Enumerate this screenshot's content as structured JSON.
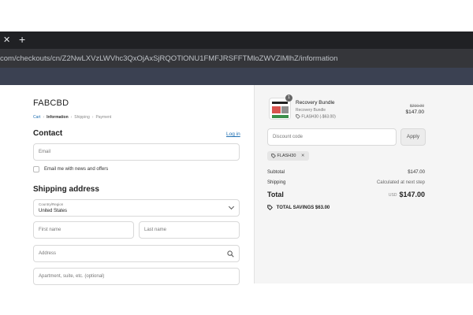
{
  "browser": {
    "tab_close": "✕",
    "tab_new": "+",
    "url": "com/checkouts/cn/Z2NwLXVzLWVhc3QxOjAxSjRQOTlONU1FMFJRSFFTMloZWVZlMlhZ/information"
  },
  "store": {
    "name": "FABCBD"
  },
  "breadcrumb": {
    "cart": "Cart",
    "information": "Information",
    "shipping": "Shipping",
    "payment": "Payment",
    "separator": "›"
  },
  "contact": {
    "heading": "Contact",
    "login_label": "Log in",
    "email_placeholder": "Email",
    "newsletter_label": "Email me with news and offers"
  },
  "shipping_address": {
    "heading": "Shipping address",
    "country_label": "Country/Region",
    "country_value": "United States",
    "first_name_placeholder": "First name",
    "last_name_placeholder": "Last name",
    "address_placeholder": "Address",
    "apartment_placeholder": "Apartment, suite, etc. (optional)"
  },
  "order": {
    "quantity": "1",
    "product_name": "Recovery Bundle",
    "product_variant": "Recovery Bundle",
    "product_discount": "FLASH30 (-$63.00)",
    "original_price": "$210.00",
    "price": "$147.00",
    "discount_placeholder": "Discount code",
    "apply_label": "Apply",
    "applied_code": "FLASH30",
    "remove_code": "✕",
    "subtotal_label": "Subtotal",
    "subtotal_value": "$147.00",
    "shipping_label": "Shipping",
    "shipping_value": "Calculated at next step",
    "total_label": "Total",
    "currency": "USD",
    "total_value": "$147.00",
    "savings_label": "TOTAL SAVINGS",
    "savings_value": "$63.00"
  },
  "colors": {
    "link": "#1f6fb2",
    "chrome_dark": "#202124",
    "summary_bg": "#f5f5f5"
  }
}
